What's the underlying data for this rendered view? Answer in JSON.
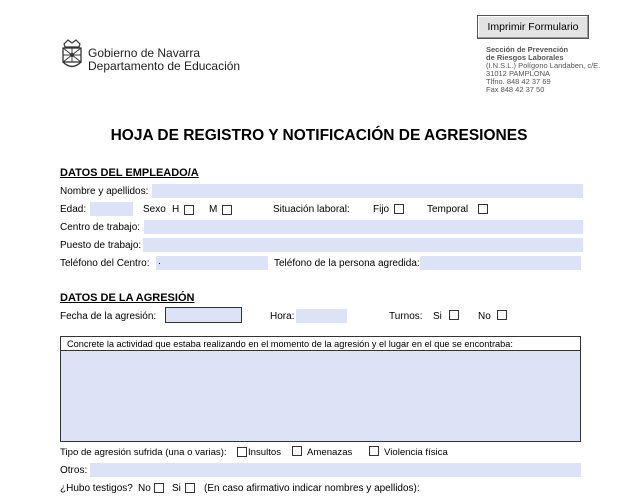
{
  "header": {
    "org_line1": "Gobierno de Navarra",
    "org_line2": "Departamento de Educación",
    "print_button": "Imprimir Formulario",
    "address_line1": "Sección de Prevención",
    "address_line2": "de Riesgos Laborales",
    "address_line3": "(I.N.S.L.) Polígono Landaben, c/E.",
    "address_line4": "31012 PAMPLONA",
    "address_line5": "Tlfno. 848 42 37 69",
    "address_line6": "Fax 848 42 37 50"
  },
  "title": "HOJA DE REGISTRO Y NOTIFICACIÓN DE AGRESIONES",
  "empleado": {
    "heading": "DATOS DEL EMPLEADO/A",
    "nombre_label": "Nombre y apellidos:",
    "edad_label": "Edad:",
    "sexo_label": "Sexo",
    "h_label": "H",
    "m_label": "M",
    "situacion_label": "Situación laboral:",
    "fijo_label": "Fijo",
    "temporal_label": "Temporal",
    "centro_label": "Centro de trabajo:",
    "puesto_label": "Puesto de trabajo:",
    "tel_centro_label": "Teléfono del Centro:",
    "tel_centro_value": ".",
    "tel_agredida_label": "Teléfono de la persona agredida:"
  },
  "agresion": {
    "heading": "DATOS DE LA AGRESIÓN",
    "fecha_label": "Fecha de la agresión:",
    "hora_label": "Hora:",
    "turnos_label": "Turnos:",
    "si_label": "Si",
    "no_label": "No",
    "actividad_label": "Concrete la actividad que estaba realizando en el momento de la agresión y el lugar en el que se encontraba:",
    "tipo_label": "Tipo de agresión sufrida (una o varias):",
    "insultos_label": "Insultos",
    "amenazas_label": "Amenazas",
    "violencia_label": "Violencia física",
    "otros_label": "Otros:",
    "testigos_label": "¿Hubo testigos?",
    "testigos_no": "No",
    "testigos_si": "Si",
    "testigos_nota": "(En caso afirmativo indicar nombres y apellidos):"
  }
}
